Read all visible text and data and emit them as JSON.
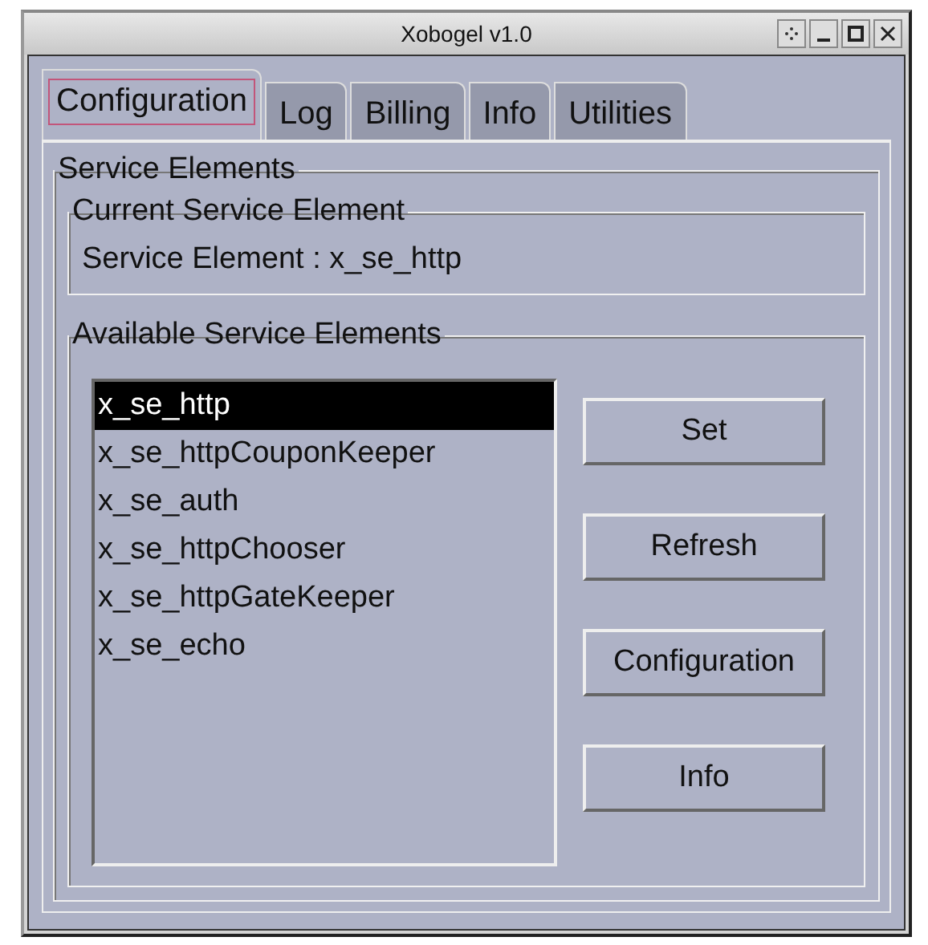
{
  "window": {
    "title": "Xobogel v1.0"
  },
  "tabs": [
    {
      "label": "Configuration",
      "selected": true
    },
    {
      "label": "Log",
      "selected": false
    },
    {
      "label": "Billing",
      "selected": false
    },
    {
      "label": "Info",
      "selected": false
    },
    {
      "label": "Utilities",
      "selected": false
    }
  ],
  "service_elements": {
    "title": "Service Elements",
    "current": {
      "title": "Current Service Element",
      "text": "Service Element : x_se_http"
    },
    "available": {
      "title": "Available Service Elements",
      "items": [
        {
          "label": "x_se_http",
          "selected": true
        },
        {
          "label": "x_se_httpCouponKeeper",
          "selected": false
        },
        {
          "label": "x_se_auth",
          "selected": false
        },
        {
          "label": "x_se_httpChooser",
          "selected": false
        },
        {
          "label": "x_se_httpGateKeeper",
          "selected": false
        },
        {
          "label": "x_se_echo",
          "selected": false
        }
      ],
      "buttons": [
        "Set",
        "Refresh",
        "Configuration",
        "Info"
      ]
    }
  }
}
